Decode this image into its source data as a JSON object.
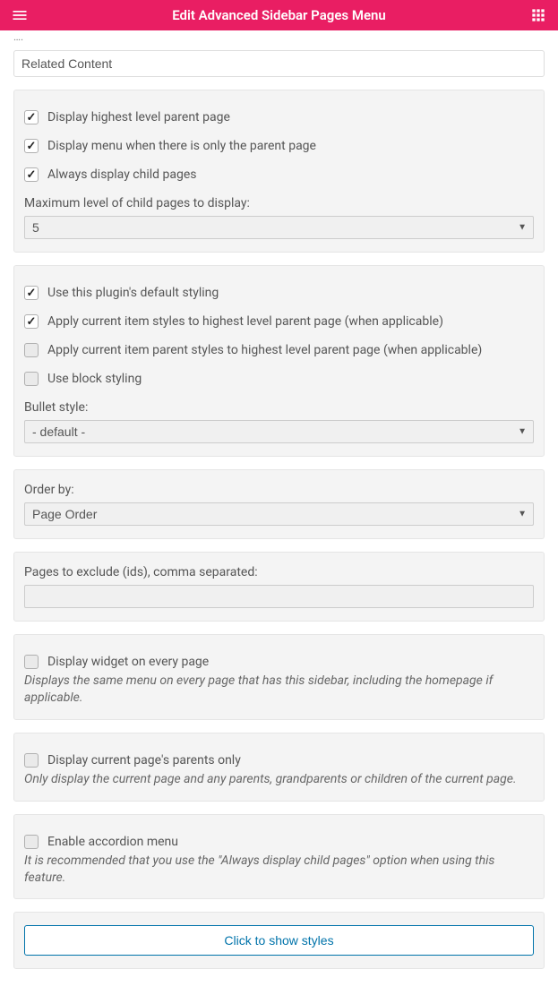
{
  "header": {
    "title": "Edit Advanced Sidebar Pages Menu"
  },
  "title_input": {
    "value": "Related Content"
  },
  "panel1": {
    "cb1": "Display highest level parent page",
    "cb2": "Display menu when there is only the parent page",
    "cb3": "Always display child pages",
    "max_label": "Maximum level of child pages to display:",
    "max_value": "5"
  },
  "panel2": {
    "cb1": "Use this plugin's default styling",
    "cb2": "Apply current item styles to highest level parent page (when applicable)",
    "cb3": "Apply current item parent styles to highest level parent page (when applicable)",
    "cb4": "Use block styling",
    "bullet_label": "Bullet style:",
    "bullet_value": "- default -"
  },
  "panel3": {
    "order_label": "Order by:",
    "order_value": "Page Order"
  },
  "panel4": {
    "exclude_label": "Pages to exclude (ids), comma separated:",
    "exclude_value": ""
  },
  "panel5": {
    "cb1": "Display widget on every page",
    "desc": "Displays the same menu on every page that has this sidebar, including the homepage if applicable."
  },
  "panel6": {
    "cb1": "Display current page's parents only",
    "desc": "Only display the current page and any parents, grandparents or children of the current page."
  },
  "panel7": {
    "cb1": "Enable accordion menu",
    "desc": "It is recommended that you use the \"Always display child pages\" option when using this feature."
  },
  "panel8": {
    "button": "Click to show styles"
  }
}
